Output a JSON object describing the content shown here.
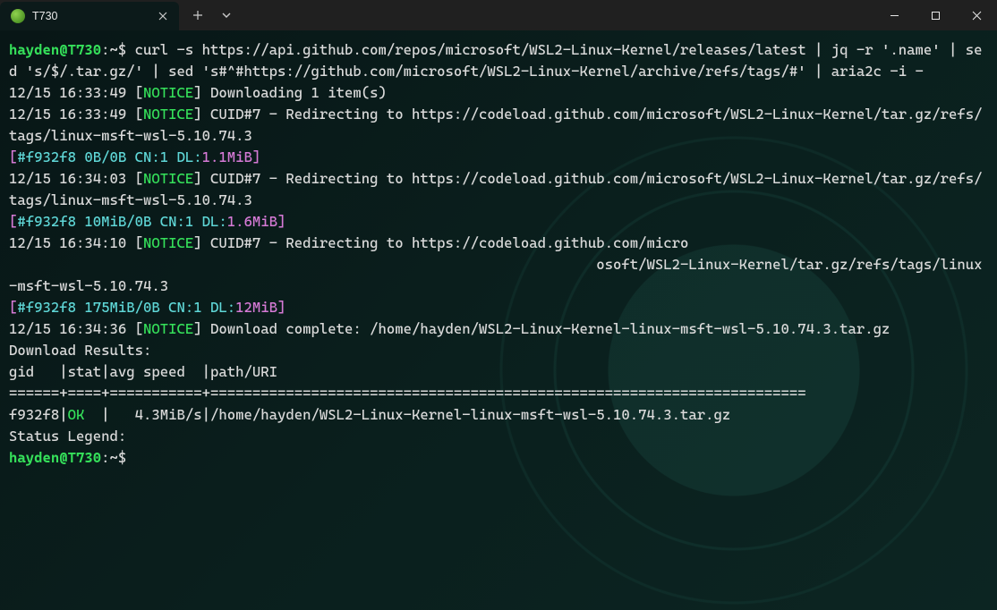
{
  "window": {
    "tab_title": "T730"
  },
  "prompt1": "hayden@T730",
  "prompt1b": ":",
  "prompt1c": "~",
  "prompt1d": "$ ",
  "cmd": "curl -s https://api.github.com/repos/microsoft/WSL2-Linux-Kernel/releases/latest | jq -r '.name' | sed 's/$/.tar.gz/' | sed 's#^#https://github.com/microsoft/WSL2-Linux-Kernel/archive/refs/tags/#' | aria2c -i -",
  "blank1": "",
  "l1a": "12/15 16:33:49 [",
  "l1b": "NOTICE",
  "l1c": "] Downloading 1 item(s)",
  "blank2": "",
  "l2a": "12/15 16:33:49 [",
  "l2b": "NOTICE",
  "l2c": "] CUID#7 - Redirecting to https://codeload.github.com/microsoft/WSL2-Linux-Kernel/tar.gz/refs/tags/linux-msft-wsl-5.10.74.3",
  "p1a": "[",
  "p1b": "#f932f8 0B/0B CN:1 DL:",
  "p1c": "1.1MiB",
  "p1d": "]",
  "l3a": "12/15 16:34:03 [",
  "l3b": "NOTICE",
  "l3c": "] CUID#7 - Redirecting to https://codeload.github.com/microsoft/WSL2-Linux-Kernel/tar.gz/refs/tags/linux-msft-wsl-5.10.74.3",
  "p2a": "[",
  "p2b": "#f932f8 10MiB/0B CN:1 DL:",
  "p2c": "1.6MiB",
  "p2d": "]",
  "l4a": "12/15 16:34:10 [",
  "l4b": "NOTICE",
  "l4c": "] CUID#7 - Redirecting to https://codeload.github.com/micro",
  "l4d": "                                                                      osoft/WSL2-Linux-Kernel/tar.gz/refs/tags/linux-msft-wsl-5.10.74.3",
  "p3a": "[",
  "p3b": "#f932f8 175MiB/0B CN:1 DL:",
  "p3c": "12MiB",
  "p3d": "]",
  "l5a": "12/15 16:34:36 [",
  "l5b": "NOTICE",
  "l5c": "] Download complete: /home/hayden/WSL2-Linux-Kernel-linux-msft-wsl-5.10.74.3.tar.gz",
  "blank3": "",
  "res1": "Download Results:",
  "res2": "gid   |stat|avg speed  |path/URI",
  "res3": "======+====+===========+=======================================================================",
  "res4a": "f932f8|",
  "res4b": "OK",
  "res4c": "  |   4.3MiB/s|/home/hayden/WSL2-Linux-Kernel-linux-msft-wsl-5.10.74.3.tar.gz",
  "blank4": "",
  "leg": "Status Legend:",
  "prompt2": "hayden@T730",
  "prompt2b": ":",
  "prompt2c": "~",
  "prompt2d": "$ "
}
